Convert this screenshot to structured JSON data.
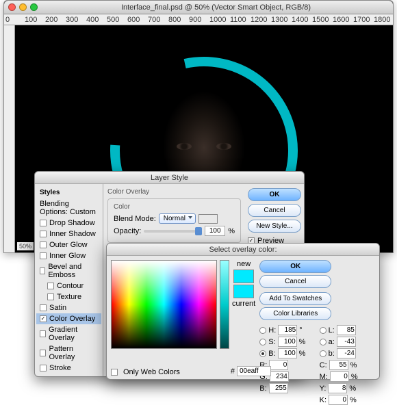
{
  "window": {
    "title": "Interface_final.psd @ 50% (Vector Smart Object, RGB/8)",
    "zoom": "50%"
  },
  "ruler_ticks": [
    "0",
    "100",
    "200",
    "300",
    "400",
    "500",
    "600",
    "700",
    "800",
    "900",
    "1000",
    "1100",
    "1200",
    "1300",
    "1400",
    "1500",
    "1600",
    "1700",
    "1800"
  ],
  "accent_color": "#00eaff",
  "layer_style": {
    "title": "Layer Style",
    "styles_label": "Styles",
    "blending_label": "Blending Options: Custom",
    "items": [
      {
        "label": "Drop Shadow",
        "checked": false
      },
      {
        "label": "Inner Shadow",
        "checked": false
      },
      {
        "label": "Outer Glow",
        "checked": false
      },
      {
        "label": "Inner Glow",
        "checked": false
      },
      {
        "label": "Bevel and Emboss",
        "checked": false
      },
      {
        "label": "Contour",
        "checked": false
      },
      {
        "label": "Texture",
        "checked": false
      },
      {
        "label": "Satin",
        "checked": false
      },
      {
        "label": "Color Overlay",
        "checked": true,
        "selected": true
      },
      {
        "label": "Gradient Overlay",
        "checked": false
      },
      {
        "label": "Pattern Overlay",
        "checked": false
      },
      {
        "label": "Stroke",
        "checked": false
      }
    ],
    "group_label": "Color Overlay",
    "color_label": "Color",
    "blend_mode_label": "Blend Mode:",
    "blend_mode_value": "Normal",
    "opacity_label": "Opacity:",
    "opacity_value": "100",
    "percent": "%",
    "buttons": {
      "ok": "OK",
      "cancel": "Cancel",
      "new_style": "New Style...",
      "preview": "Preview"
    }
  },
  "picker": {
    "title": "Select overlay color:",
    "new_label": "new",
    "current_label": "current",
    "ok": "OK",
    "cancel": "Cancel",
    "add": "Add To Swatches",
    "lib": "Color Libraries",
    "H": {
      "l": "H:",
      "v": "185",
      "u": "°"
    },
    "S": {
      "l": "S:",
      "v": "100",
      "u": "%"
    },
    "B": {
      "l": "B:",
      "v": "100",
      "u": "%"
    },
    "R": {
      "l": "R:",
      "v": "0"
    },
    "G": {
      "l": "G:",
      "v": "234"
    },
    "Bc": {
      "l": "B:",
      "v": "255"
    },
    "L": {
      "l": "L:",
      "v": "85"
    },
    "a": {
      "l": "a:",
      "v": "-43"
    },
    "b": {
      "l": "b:",
      "v": "-24"
    },
    "C": {
      "l": "C:",
      "v": "55",
      "u": "%"
    },
    "M": {
      "l": "M:",
      "v": "0",
      "u": "%"
    },
    "Y": {
      "l": "Y:",
      "v": "8",
      "u": "%"
    },
    "K": {
      "l": "K:",
      "v": "0",
      "u": "%"
    },
    "web": "Only Web Colors",
    "hash": "#",
    "hex": "00eaff"
  }
}
